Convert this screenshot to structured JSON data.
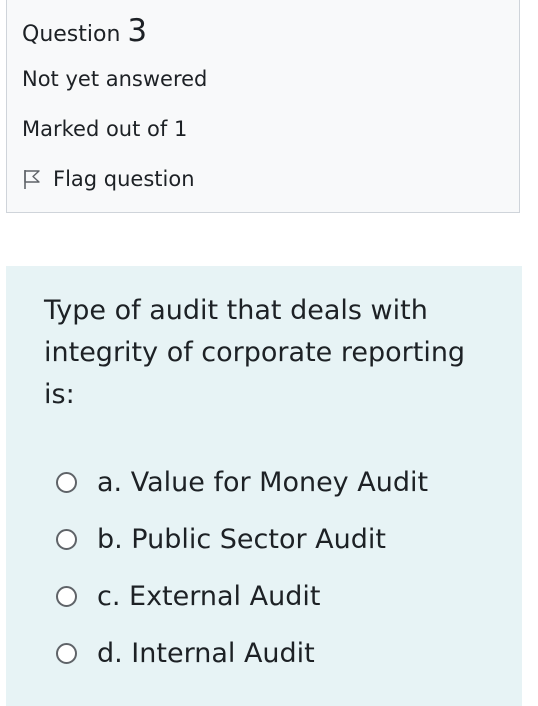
{
  "question_info": {
    "heading_label": "Question",
    "number": "3",
    "state": "Not yet answered",
    "grade": "Marked out of 1",
    "flag_label": "Flag question",
    "flag_icon": "flag-icon"
  },
  "question": {
    "text": "Type of audit that deals with integrity of corporate reporting is:",
    "answers": [
      {
        "label": "a. Value for Money Audit",
        "selected": false
      },
      {
        "label": "b. Public Sector Audit",
        "selected": false
      },
      {
        "label": "c. External Audit",
        "selected": false
      },
      {
        "label": "d. Internal Audit",
        "selected": false
      }
    ]
  },
  "colors": {
    "info_background": "#f8f9fa",
    "info_border": "#cfd4da",
    "formulation_background": "#e7f3f5",
    "text": "#1d2125"
  }
}
